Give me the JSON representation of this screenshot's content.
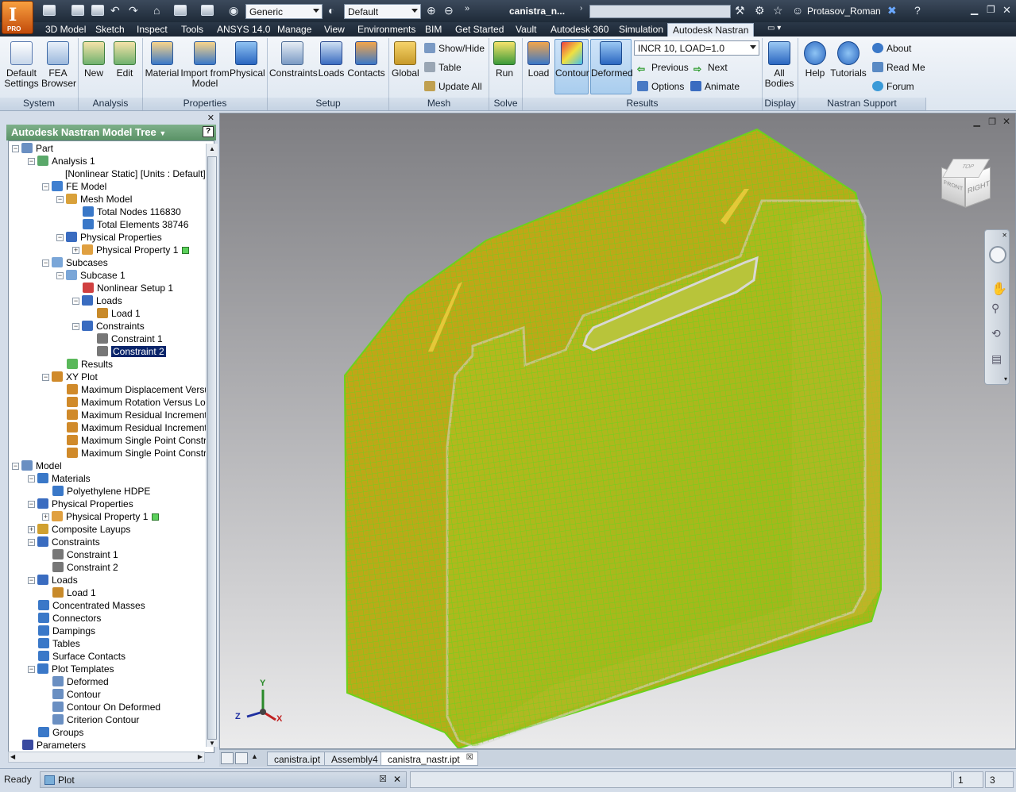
{
  "titlebar": {
    "app_button": {
      "letter": "I",
      "badge": "PRO"
    },
    "material_combo": "Generic",
    "appearance_combo": "Default",
    "document_title": "canistra_n...",
    "user": "Protasov_Roman"
  },
  "tabs": [
    "3D Model",
    "Sketch",
    "Inspect",
    "Tools",
    "ANSYS 14.0",
    "Manage",
    "View",
    "Environments",
    "BIM",
    "Get Started",
    "Vault",
    "Autodesk 360",
    "Simulation",
    "Autodesk Nastran"
  ],
  "active_tab": "Autodesk Nastran",
  "ribbon": {
    "default_settings": "Default Settings",
    "fea_browser": "FEA Browser",
    "new": "New",
    "edit": "Edit",
    "material": "Material",
    "import_from_model": "Import from Model",
    "physical": "Physical",
    "constraints": "Constraints",
    "loads": "Loads",
    "contacts": "Contacts",
    "global": "Global",
    "show_hide": "Show/Hide",
    "table": "Table",
    "update_all": "Update  All",
    "run": "Run",
    "load": "Load",
    "contour": "Contour",
    "deformed": "Deformed",
    "result_combo": "INCR 10, LOAD=1.0",
    "previous": "Previous",
    "next": "Next",
    "options": "Options",
    "animate": "Animate",
    "all_bodies": "All Bodies",
    "help": "Help",
    "tutorials": "Tutorials",
    "about": "About",
    "read_me": "Read Me",
    "forum": "Forum",
    "groups": {
      "system": "System",
      "analysis": "Analysis",
      "properties": "Properties",
      "setup": "Setup",
      "mesh": "Mesh",
      "solve": "Solve",
      "results": "Results",
      "display": "Display",
      "nastran_support": "Nastran Support"
    }
  },
  "tree": {
    "title": "Autodesk Nastran Model Tree",
    "help": "?",
    "items": [
      {
        "label": "Part",
        "toggle": "−",
        "icon": "part-icon",
        "color": "#6a8fc2"
      },
      {
        "label": "Analysis 1",
        "toggle": "−",
        "icon": "analysis-icon",
        "color": "#5aa86a"
      },
      {
        "label": "[Nonlinear Static] [Units : Default]",
        "toggle": "",
        "icon": "",
        "color": ""
      },
      {
        "label": "FE Model",
        "toggle": "−",
        "icon": "fe-model-icon",
        "color": "#3f7fd0"
      },
      {
        "label": "Mesh Model",
        "toggle": "−",
        "icon": "mesh-icon",
        "color": "#d9a13a"
      },
      {
        "label": "Total Nodes 116830",
        "toggle": "",
        "icon": "node-icon",
        "color": "#3a78c8"
      },
      {
        "label": "Total Elements 38746",
        "toggle": "",
        "icon": "element-icon",
        "color": "#3a78c8"
      },
      {
        "label": "Physical Properties",
        "toggle": "−",
        "icon": "property-icon",
        "color": "#3a6cc0"
      },
      {
        "label": "Physical Property 1",
        "toggle": "+",
        "icon": "property-item-icon",
        "color": "#e0a040",
        "swatch": "#5cd05c"
      },
      {
        "label": "Subcases",
        "toggle": "−",
        "icon": "subcases-icon",
        "color": "#7aa6d8"
      },
      {
        "label": "Subcase 1",
        "toggle": "−",
        "icon": "subcase-icon",
        "color": "#7aa6d8"
      },
      {
        "label": "Nonlinear Setup 1",
        "toggle": "",
        "icon": "setup-icon",
        "color": "#d04040"
      },
      {
        "label": "Loads",
        "toggle": "−",
        "icon": "loads-icon",
        "color": "#3a6cc0"
      },
      {
        "label": "Load 1",
        "toggle": "",
        "icon": "load-icon",
        "color": "#c88a2a"
      },
      {
        "label": "Constraints",
        "toggle": "−",
        "icon": "constraints-icon",
        "color": "#3a6cc0"
      },
      {
        "label": "Constraint 1",
        "toggle": "",
        "icon": "constraint-icon",
        "color": "#777777"
      },
      {
        "label": "Constraint 2",
        "toggle": "",
        "icon": "constraint-icon",
        "color": "#777777",
        "selected": true
      },
      {
        "label": "Results",
        "toggle": "",
        "icon": "results-icon",
        "color": "#5ab85a"
      },
      {
        "label": "XY Plot",
        "toggle": "−",
        "icon": "xyplot-icon",
        "color": "#d08a2a"
      },
      {
        "label": "Maximum Displacement Versus",
        "toggle": "",
        "icon": "plot-icon",
        "color": "#d08a2a"
      },
      {
        "label": "Maximum Rotation Versus Loac",
        "toggle": "",
        "icon": "plot-icon",
        "color": "#d08a2a"
      },
      {
        "label": "Maximum Residual Incremental",
        "toggle": "",
        "icon": "plot-icon",
        "color": "#d08a2a"
      },
      {
        "label": "Maximum Residual Incremental",
        "toggle": "",
        "icon": "plot-icon",
        "color": "#d08a2a"
      },
      {
        "label": "Maximum Single Point Constrair",
        "toggle": "",
        "icon": "plot-icon",
        "color": "#d08a2a"
      },
      {
        "label": "Maximum Single Point Constrair",
        "toggle": "",
        "icon": "plot-icon",
        "color": "#d08a2a"
      },
      {
        "label": "Model",
        "toggle": "−",
        "icon": "model-icon",
        "color": "#6a8fc2"
      },
      {
        "label": "Materials",
        "toggle": "−",
        "icon": "materials-icon",
        "color": "#3a78c8"
      },
      {
        "label": "Polyethylene HDPE",
        "toggle": "",
        "icon": "material-icon",
        "color": "#3a78c8"
      },
      {
        "label": "Physical Properties",
        "toggle": "−",
        "icon": "property-icon",
        "color": "#3a6cc0"
      },
      {
        "label": "Physical Property 1",
        "toggle": "+",
        "icon": "property-item-icon",
        "color": "#e0a040",
        "swatch": "#5cd05c"
      },
      {
        "label": "Composite Layups",
        "toggle": "+",
        "icon": "layup-icon",
        "color": "#d0a030"
      },
      {
        "label": "Constraints",
        "toggle": "−",
        "icon": "constraints-icon",
        "color": "#3a6cc0"
      },
      {
        "label": "Constraint 1",
        "toggle": "",
        "icon": "constraint-icon",
        "color": "#777777"
      },
      {
        "label": "Constraint 2",
        "toggle": "",
        "icon": "constraint-icon",
        "color": "#777777"
      },
      {
        "label": "Loads",
        "toggle": "−",
        "icon": "loads-icon",
        "color": "#3a6cc0"
      },
      {
        "label": "Load 1",
        "toggle": "",
        "icon": "load-icon",
        "color": "#c88a2a"
      },
      {
        "label": "Concentrated Masses",
        "toggle": "",
        "icon": "mass-icon",
        "color": "#3a78c8"
      },
      {
        "label": "Connectors",
        "toggle": "",
        "icon": "connector-icon",
        "color": "#3a78c8"
      },
      {
        "label": "Dampings",
        "toggle": "",
        "icon": "damping-icon",
        "color": "#3a78c8"
      },
      {
        "label": "Tables",
        "toggle": "",
        "icon": "table-icon",
        "color": "#3a78c8"
      },
      {
        "label": "Surface Contacts",
        "toggle": "",
        "icon": "contact-icon",
        "color": "#3a78c8"
      },
      {
        "label": "Plot Templates",
        "toggle": "−",
        "icon": "templates-icon",
        "color": "#3a78c8"
      },
      {
        "label": "Deformed",
        "toggle": "",
        "icon": "template-icon",
        "color": "#6a8fc2"
      },
      {
        "label": "Contour",
        "toggle": "",
        "icon": "template-icon",
        "color": "#6a8fc2"
      },
      {
        "label": "Contour On Deformed",
        "toggle": "",
        "icon": "template-icon",
        "color": "#6a8fc2"
      },
      {
        "label": "Criterion Contour",
        "toggle": "",
        "icon": "template-icon",
        "color": "#6a8fc2"
      },
      {
        "label": "Groups",
        "toggle": "",
        "icon": "groups-icon",
        "color": "#3a78c8"
      },
      {
        "label": "Parameters",
        "toggle": "",
        "icon": "parameters-icon",
        "color": "#3a4aa0"
      }
    ]
  },
  "viewcube": {
    "front": "FRONT",
    "right": "RIGHT",
    "top": "TOP"
  },
  "triad": {
    "x": "X",
    "y": "Y",
    "z": "Z"
  },
  "doc_tabs": [
    "canistra.ipt",
    "Assembly4",
    "canistra_nastr.ipt"
  ],
  "active_doc": "canistra_nastr.ipt",
  "status": {
    "ready": "Ready",
    "panel": "Plot",
    "num1": "1",
    "num2": "3"
  },
  "colors": {
    "mesh_fill": "#b4c41e",
    "mesh_line": "#6cd21c",
    "highlight": "#e0b030",
    "selection": "#0a246a"
  }
}
